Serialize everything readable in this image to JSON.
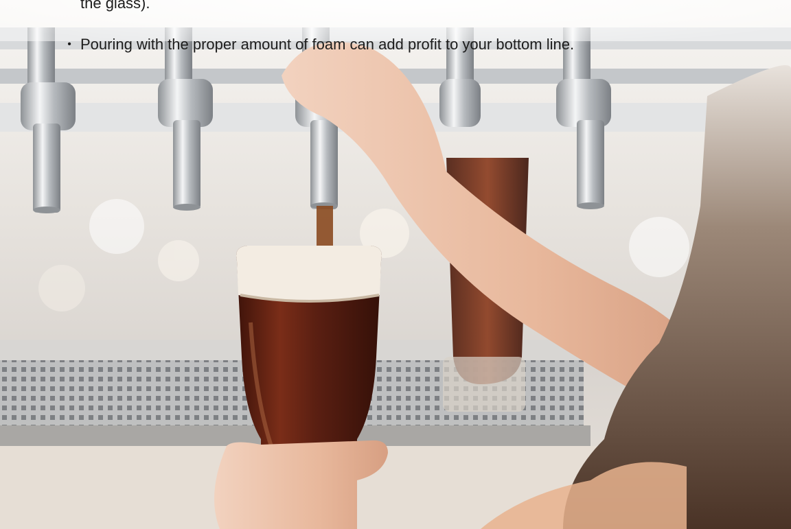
{
  "slide": {
    "continuation_text": "the glass).",
    "bullet_text": "Pouring with the proper amount of foam can add profit to your bottom line."
  },
  "photo": {
    "subject": "bartender-pouring-beer",
    "colors": {
      "beer": "#5a1f12",
      "foam": "#f3ece2",
      "chrome": "#c9ccd0",
      "background": "#eee9e3",
      "hair": "#5c4636",
      "skin": "#e6b59a"
    }
  }
}
